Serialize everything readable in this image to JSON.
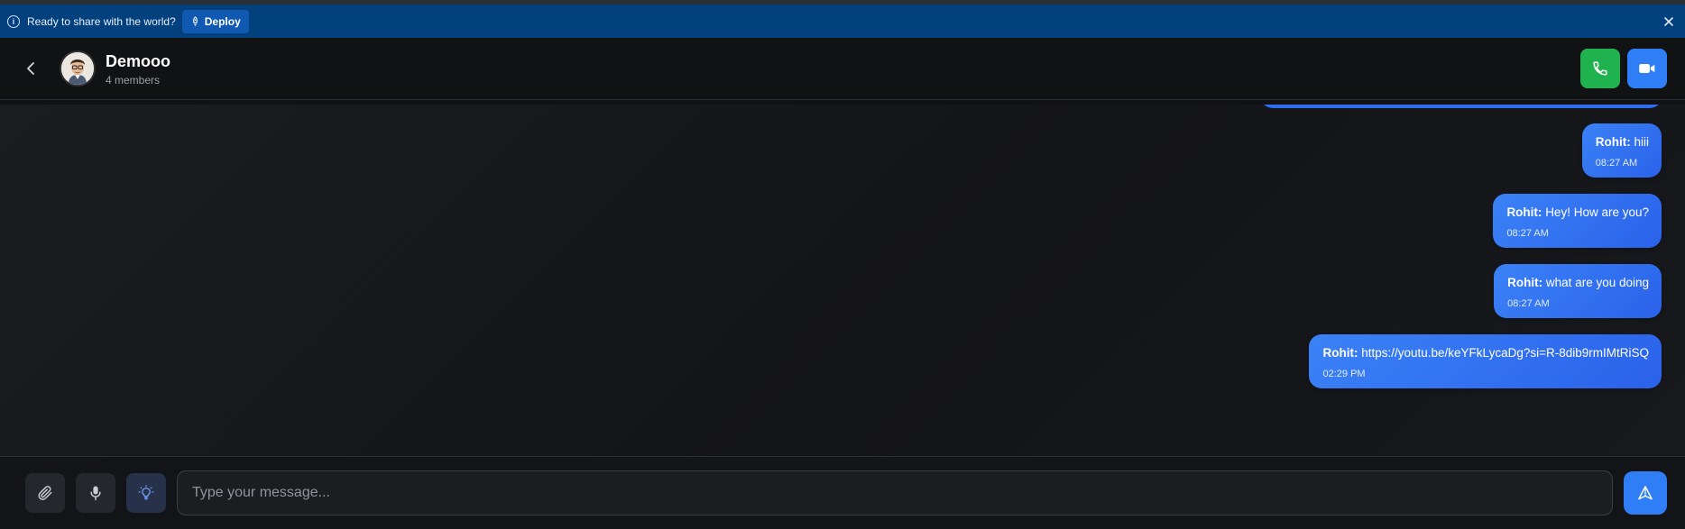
{
  "banner": {
    "message": "Ready to share with the world?",
    "deploy_label": "Deploy",
    "info_icon": "info-icon",
    "close_icon": "close-icon"
  },
  "header": {
    "back_icon": "chevron-left-icon",
    "title": "Demooo",
    "subtitle": "4 members",
    "call_icon": "phone-icon",
    "video_icon": "video-icon"
  },
  "messages": [
    {
      "sender": "Rohit:",
      "text": "hiii",
      "time": "08:27 AM"
    },
    {
      "sender": "Rohit:",
      "text": "Hey! How are you?",
      "time": "08:27 AM"
    },
    {
      "sender": "Rohit:",
      "text": "what are you doing",
      "time": "08:27 AM"
    },
    {
      "sender": "Rohit:",
      "text": "https://youtu.be/keYFkLycaDg?si=R-8dib9rmIMtRiSQ",
      "time": "02:29 PM"
    }
  ],
  "composer": {
    "placeholder": "Type your message...",
    "attach_icon": "paperclip-icon",
    "mic_icon": "microphone-icon",
    "idea_icon": "lightbulb-icon",
    "send_icon": "send-icon"
  },
  "colors": {
    "banner_bg": "#03407e",
    "bubble": "#3b82f6",
    "call_green": "#1fb24f",
    "accent_blue": "#2f7ef5"
  }
}
